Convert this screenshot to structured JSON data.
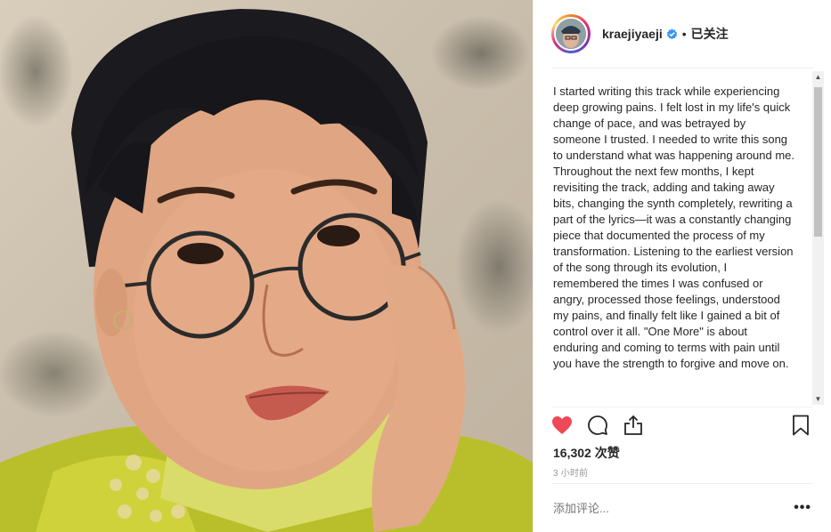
{
  "post": {
    "photo_alt": "Portrait photo",
    "user": {
      "username": "kraejiyaeji",
      "verified": true,
      "separator": "•",
      "follow_status": "已关注"
    },
    "caption": "I started writing this track while experiencing deep growing pains. I felt lost in my life's quick change of pace, and was betrayed by someone I trusted. I needed to write this song to understand what was happening around me. Throughout the next few months, I kept revisiting the track, adding and taking away bits, changing the synth completely, rewriting a part of the lyrics—it was a constantly changing piece that documented the process of my transformation. Listening to the earliest version of the song through its evolution, I remembered the times I was confused or angry, processed those feelings, understood my pains, and finally felt like I gained a bit of control over it all. \"One More\" is about enduring and coming to terms with pain until you have the strength to forgive and move on.",
    "likes_label": "16,302 次赞",
    "timestamp": "3 小时前",
    "comment_placeholder": "添加评论...",
    "more_label": "•••",
    "icons": {
      "like": "heart-filled-icon",
      "comment": "comment-bubble-icon",
      "share": "share-icon",
      "save": "bookmark-icon",
      "verified": "verified-badge-icon"
    },
    "colors": {
      "like": "#ed4956",
      "verified": "#3897f0",
      "text": "#262626",
      "muted": "#999999"
    }
  }
}
